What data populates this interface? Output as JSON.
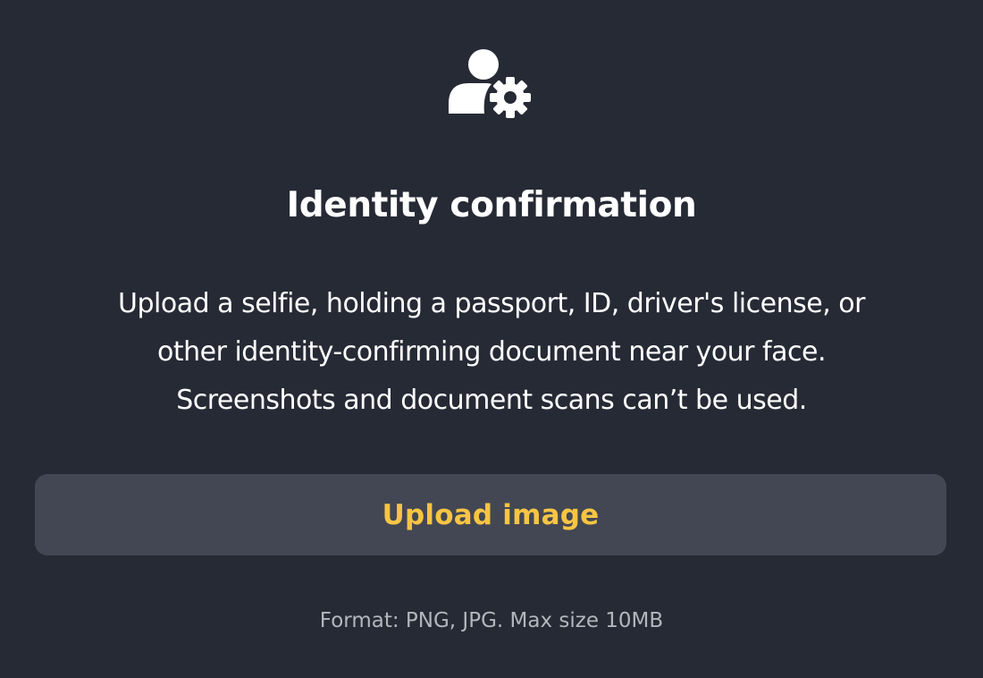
{
  "header": {
    "icon": "user-gear-icon",
    "title": "Identity confirmation"
  },
  "description": {
    "lines": [
      "Upload a selfie, holding a passport, ID, driver's license, or",
      "other identity-confirming document near your face.",
      "Screenshots and document scans can’t be used."
    ]
  },
  "upload": {
    "button_label": "Upload image",
    "hint": "Format: PNG, JPG. Max size 10MB"
  },
  "colors": {
    "background": "#262a35",
    "button_background": "#434753",
    "accent": "#f7c543",
    "text": "#ffffff",
    "muted_text": "#b4b6bd"
  }
}
